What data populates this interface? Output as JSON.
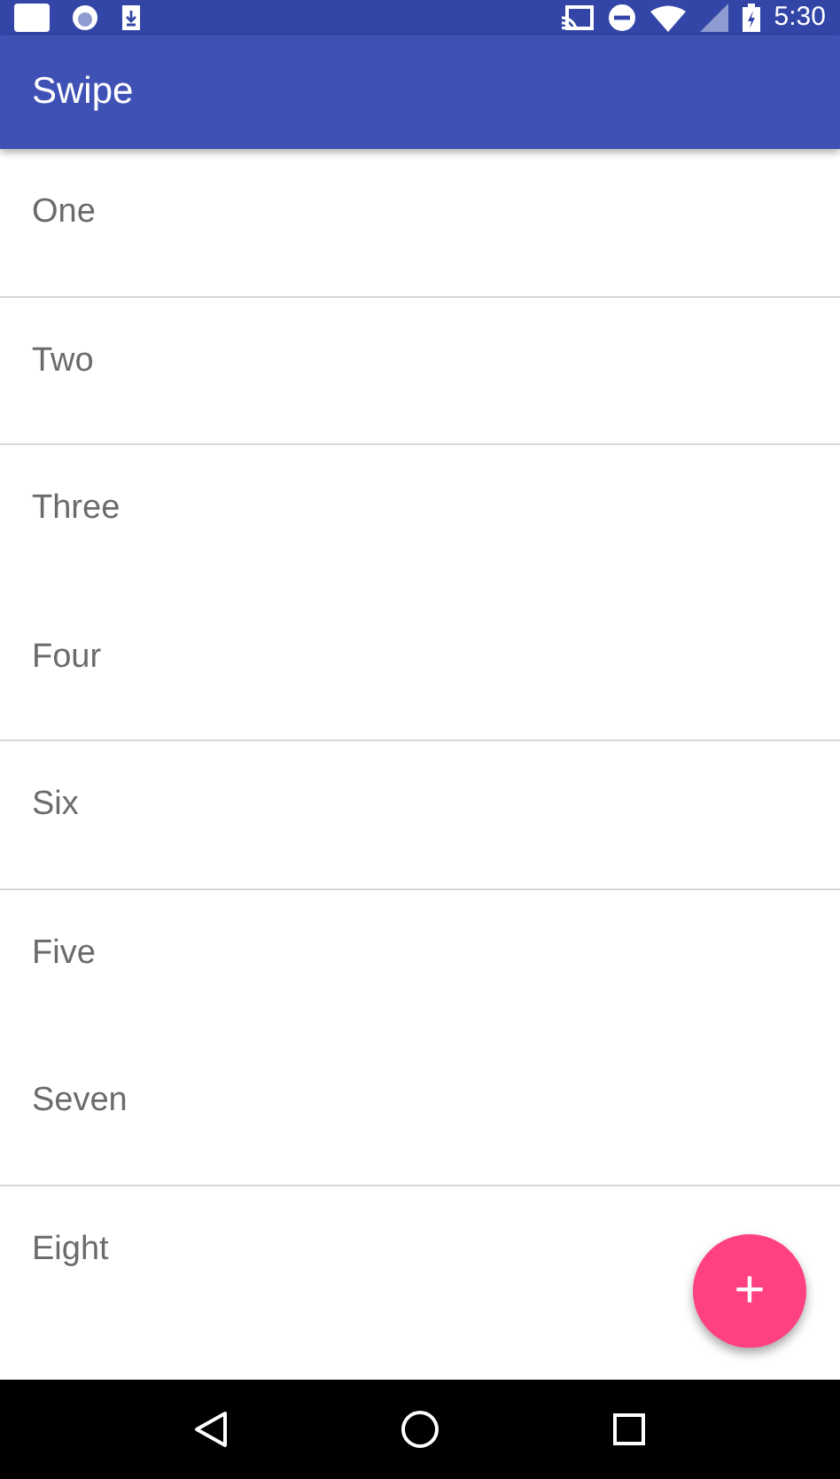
{
  "status_bar": {
    "time": "5:30"
  },
  "app_bar": {
    "title": "Swipe"
  },
  "list": [
    {
      "label": "One",
      "divider": true
    },
    {
      "label": "Two",
      "divider": true
    },
    {
      "label": "Three",
      "divider": false
    },
    {
      "label": "Four",
      "divider": true
    },
    {
      "label": "Six",
      "divider": true
    },
    {
      "label": "Five",
      "divider": false
    },
    {
      "label": "Seven",
      "divider": true
    },
    {
      "label": "Eight",
      "divider": false
    }
  ],
  "fab": {
    "label": "+"
  }
}
